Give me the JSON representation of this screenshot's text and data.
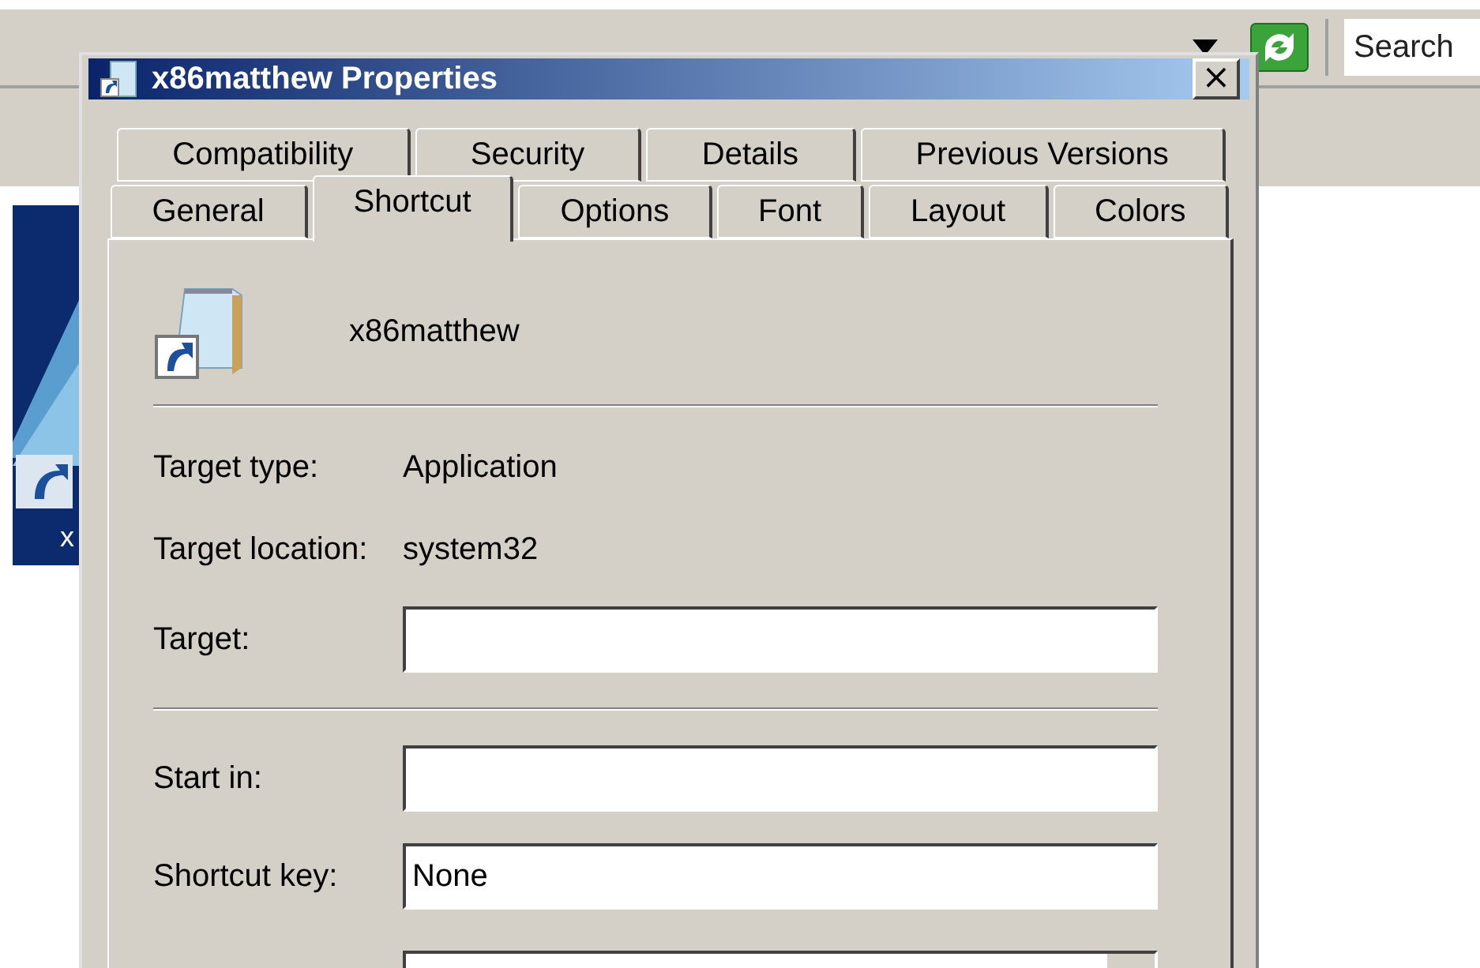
{
  "toolbar": {
    "search": {
      "placeholder": "Search"
    }
  },
  "desktop_icon": {
    "label": "x"
  },
  "dialog": {
    "title": "x86matthew Properties",
    "close": "×",
    "tab_rows": [
      [
        {
          "label": "Compatibility",
          "selected": false
        },
        {
          "label": "Security",
          "selected": false
        },
        {
          "label": "Details",
          "selected": false
        },
        {
          "label": "Previous Versions",
          "selected": false
        }
      ],
      [
        {
          "label": "General",
          "selected": false
        },
        {
          "label": "Shortcut",
          "selected": true
        },
        {
          "label": "Options",
          "selected": false
        },
        {
          "label": "Font",
          "selected": false
        },
        {
          "label": "Layout",
          "selected": false
        },
        {
          "label": "Colors",
          "selected": false
        }
      ]
    ],
    "name": "x86matthew",
    "info": [
      {
        "label": "Target type:",
        "value": "Application"
      },
      {
        "label": "Target location:",
        "value": "system32"
      }
    ],
    "fields": [
      {
        "kind": "text",
        "label": "Target:"
      },
      {
        "kind": "divider"
      },
      {
        "kind": "text",
        "label": "Start in:"
      },
      {
        "kind": "text",
        "label": "Shortcut key:",
        "value": "None"
      },
      {
        "kind": "dropdown"
      }
    ]
  }
}
